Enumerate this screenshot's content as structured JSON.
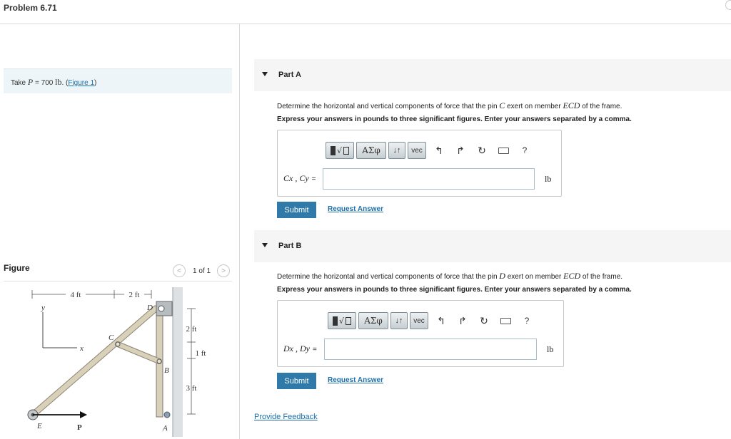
{
  "header": {
    "title": "Problem 6.71"
  },
  "problem": {
    "take_text": "Take",
    "variable": "P",
    "equals_value": " = 700 ",
    "unit": "lb",
    "period": ". (",
    "figure_link": "Figure 1",
    "close_paren": ")"
  },
  "figure": {
    "label": "Figure",
    "pager": "1 of 1",
    "prev_icon": "chevron-left-icon",
    "next_icon": "chevron-right-icon",
    "dims": {
      "d4ft": "4 ft",
      "d2ft_top": "2 ft",
      "d2ft": "2 ft",
      "d1ft": "1 ft",
      "d3ft": "3 ft"
    },
    "points": {
      "D": "D",
      "C": "C",
      "B": "B",
      "A": "A",
      "E": "E",
      "P": "P",
      "x": "x",
      "y": "y"
    }
  },
  "toolbar": {
    "greek": "ΑΣφ",
    "arrows": "↓↑",
    "vec": "vec",
    "undo": "↰",
    "redo": "↱",
    "reset": "↻",
    "help": "?"
  },
  "part_a": {
    "title": "Part A",
    "q_before": "Determine the horizontal and vertical components of force that the pin ",
    "q_pin": "C",
    "q_middle": " exert on member ",
    "q_member": "ECD",
    "q_after": " of the frame.",
    "instruction": "Express your answers in pounds to three significant figures. Enter your answers separated by a comma.",
    "answer_label": "Cx , Cy",
    "equals": "=",
    "input_value": "",
    "unit": "lb",
    "submit": "Submit",
    "request": "Request Answer"
  },
  "part_b": {
    "title": "Part B",
    "q_before": "Determine the horizontal and vertical components of force that the pin ",
    "q_pin": "D",
    "q_middle": " exert on member ",
    "q_member": "ECD",
    "q_after": " of the frame.",
    "instruction": "Express your answers in pounds to three significant figures. Enter your answers separated by a comma.",
    "answer_label": "Dx , Dy",
    "equals": "=",
    "input_value": "",
    "unit": "lb",
    "submit": "Submit",
    "request": "Request Answer"
  },
  "footer": {
    "feedback": "Provide Feedback"
  },
  "colors": {
    "accent": "#2f7aa8",
    "link": "#1e6fa8",
    "take_bg": "#eef5f8",
    "part_header_bg": "#f5f5f5"
  }
}
